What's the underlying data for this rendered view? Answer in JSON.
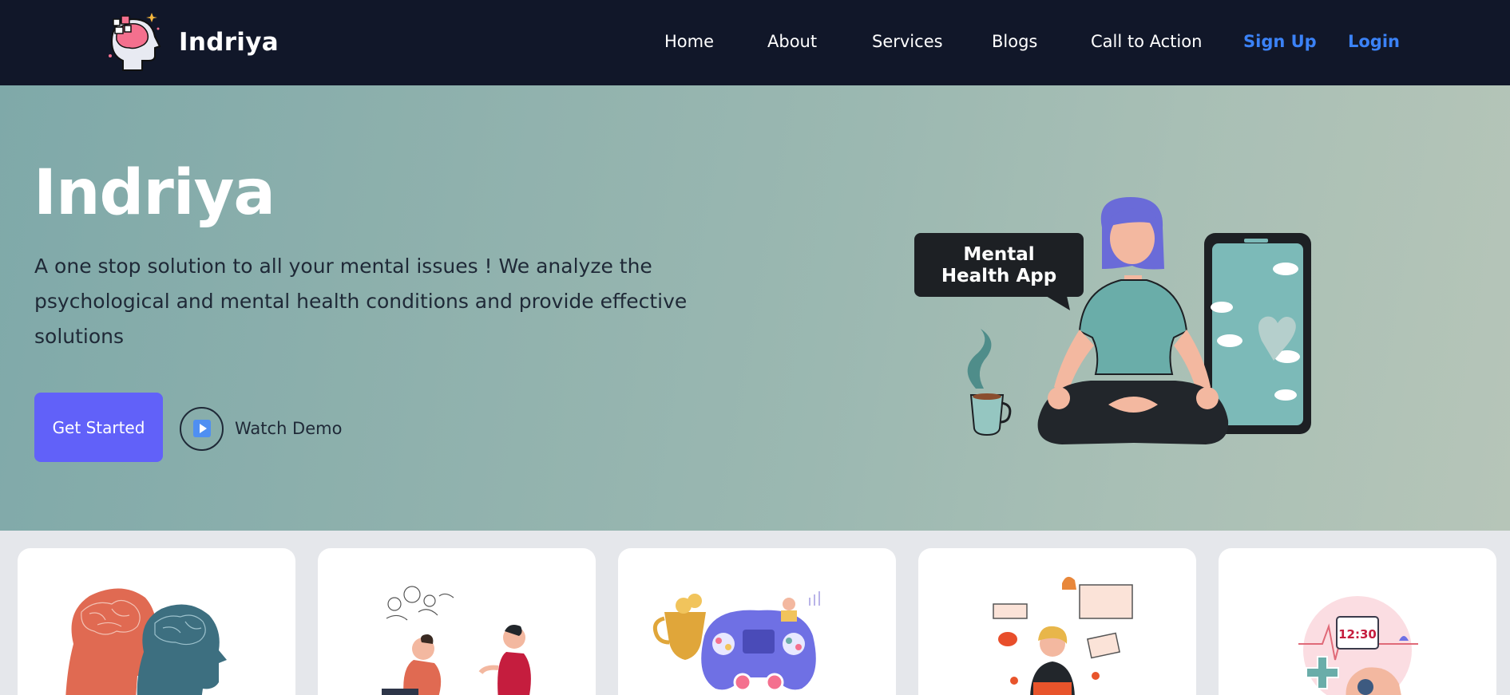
{
  "nav": {
    "brand": "Indriya",
    "links": [
      {
        "label": "Home"
      },
      {
        "label": "About"
      },
      {
        "label": "Services"
      },
      {
        "label": "Blogs"
      },
      {
        "label": "Call to Action"
      }
    ],
    "signup": "Sign Up",
    "login": "Login"
  },
  "hero": {
    "title": "Indriya",
    "description": "A one stop solution to all your mental issues ! We analyze the psychological and mental health conditions and provide effective solutions",
    "primary_button": "Get Started",
    "secondary_button": "Watch Demo",
    "illustration_text_line1": "Mental",
    "illustration_text_line2": "Health App",
    "play_icon": "play-icon"
  },
  "cards": [
    {
      "icon": "two-heads-brain-illustration"
    },
    {
      "icon": "therapy-session-illustration"
    },
    {
      "icon": "gamepad-trophy-illustration"
    },
    {
      "icon": "notifications-person-illustration"
    },
    {
      "icon": "medicine-reminder-illustration"
    }
  ],
  "colors": {
    "nav_bg": "#111729",
    "accent_link": "#3b82f6",
    "primary_button": "#6161f9",
    "hero_text": "#1f2937"
  },
  "clock_text": "12:30"
}
